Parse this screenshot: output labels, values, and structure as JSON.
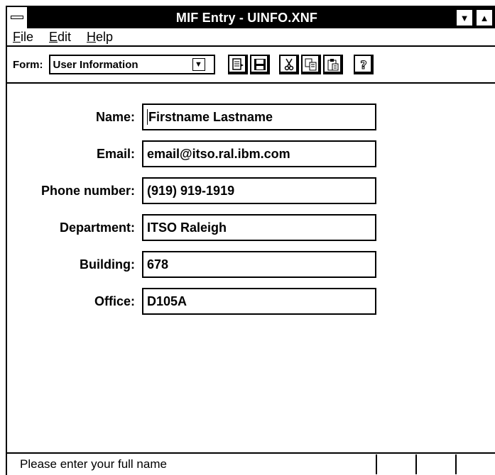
{
  "window": {
    "title": "MIF Entry - UINFO.XNF"
  },
  "menu": {
    "file": "File",
    "file_key": "F",
    "file_rest": "ile",
    "edit": "Edit",
    "edit_key": "E",
    "edit_rest": "dit",
    "help": "Help",
    "help_key": "H",
    "help_rest": "elp"
  },
  "toolbar": {
    "form_label": "Form:",
    "form_value": "User Information"
  },
  "fields": [
    {
      "label": "Name:",
      "value": "Firstname Lastname"
    },
    {
      "label": "Email:",
      "value": "email@itso.ral.ibm.com"
    },
    {
      "label": "Phone number:",
      "value": "(919) 919-1919"
    },
    {
      "label": "Department:",
      "value": "ITSO Raleigh"
    },
    {
      "label": "Building:",
      "value": "678"
    },
    {
      "label": "Office:",
      "value": "D105A"
    }
  ],
  "status": {
    "message": "Please enter your full name"
  }
}
